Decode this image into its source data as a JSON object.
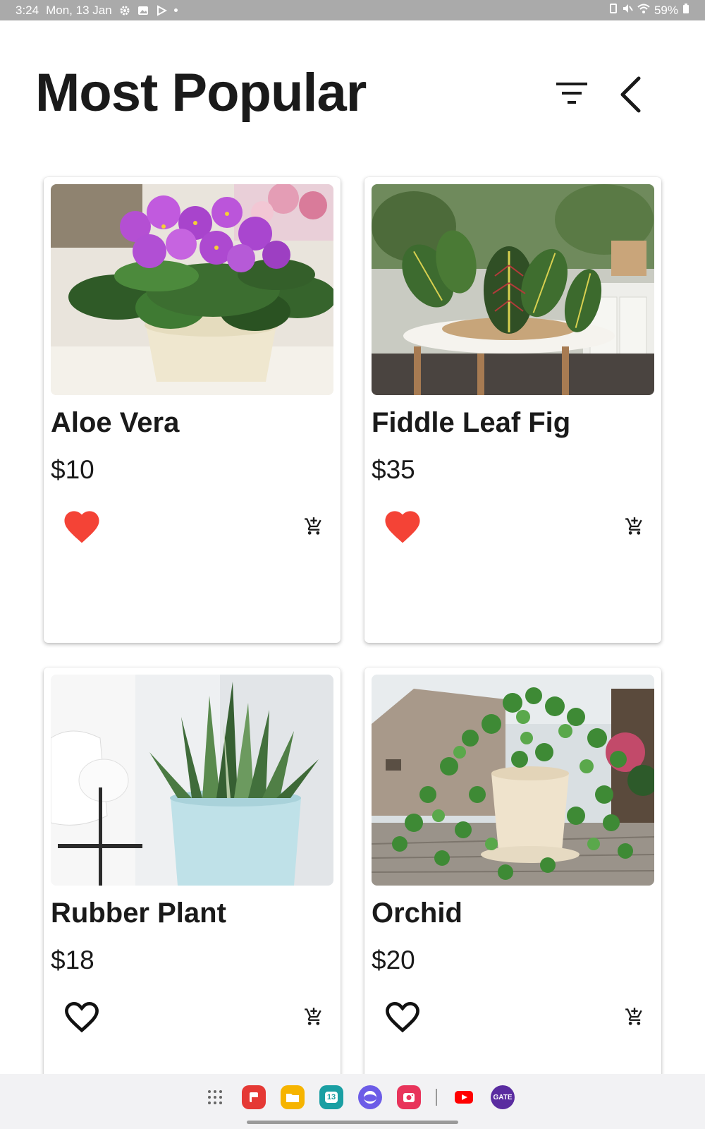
{
  "status_bar": {
    "time": "3:24",
    "date": "Mon, 13 Jan",
    "battery": "59%"
  },
  "header": {
    "title": "Most Popular",
    "filter_icon": "filter-icon",
    "back_icon": "chevron-left-icon"
  },
  "products": [
    {
      "name": "Aloe Vera",
      "price": "$10",
      "favorited": true,
      "image": "purple-african-violet-in-cream-pot"
    },
    {
      "name": "Fiddle Leaf Fig",
      "price": "$35",
      "favorited": true,
      "image": "prayer-plant-on-side-table"
    },
    {
      "name": "Rubber Plant",
      "price": "$18",
      "favorited": false,
      "image": "snake-plant-in-light-blue-pot"
    },
    {
      "name": "Orchid",
      "price": "$20",
      "favorited": false,
      "image": "ivy-in-cream-pot-outdoors"
    }
  ],
  "colors": {
    "heart_filled": "#f44336",
    "text": "#1a1a1a",
    "status_bar": "#aaaaaa"
  },
  "dock": {
    "apps": [
      "app-grid-icon",
      "flipboard-app",
      "files-app",
      "calendar-app",
      "browser-app",
      "camera-app",
      "youtube-app",
      "gate-app"
    ],
    "calendar_day": "13",
    "gate_label": "GATE"
  }
}
